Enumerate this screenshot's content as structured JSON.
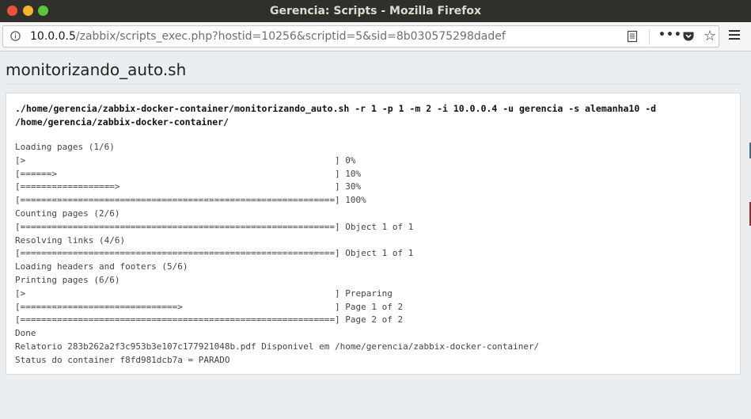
{
  "window": {
    "title": "Gerencia: Scripts - Mozilla Firefox"
  },
  "toolbar": {
    "url_host": "10.0.0.5",
    "url_path": "/zabbix/scripts_exec.php?hostid=10256&scriptid=5&sid=8b030575298dadef",
    "icons": [
      "info-icon",
      "reader-view-icon",
      "page-actions-icon",
      "pocket-icon",
      "bookmark-star-icon",
      "hamburger-menu-icon"
    ]
  },
  "page": {
    "title": "monitorizando_auto.sh",
    "command_line1": "./home/gerencia/zabbix-docker-container/monitorizando_auto.sh -r 1 -p 1 -m 2 -i 10.0.0.4 -u gerencia -s alemanha10 -d",
    "command_line2": "/home/gerencia/zabbix-docker-container/",
    "output": "Loading pages (1/6)\n[>                                                           ] 0%\n[======>                                                     ] 10%\n[==================>                                         ] 30%\n[============================================================] 100%\nCounting pages (2/6)\n[============================================================] Object 1 of 1\nResolving links (4/6)\n[============================================================] Object 1 of 1\nLoading headers and footers (5/6)\nPrinting pages (6/6)\n[>                                                           ] Preparing\n[==============================>                             ] Page 1 of 2\n[============================================================] Page 2 of 2\nDone\nRelatorio 283b262a2f3c953b3e107c177921048b.pdf Disponivel em /home/gerencia/zabbix-docker-container/\nStatus do container f8fd981dcb7a = PARADO"
  }
}
